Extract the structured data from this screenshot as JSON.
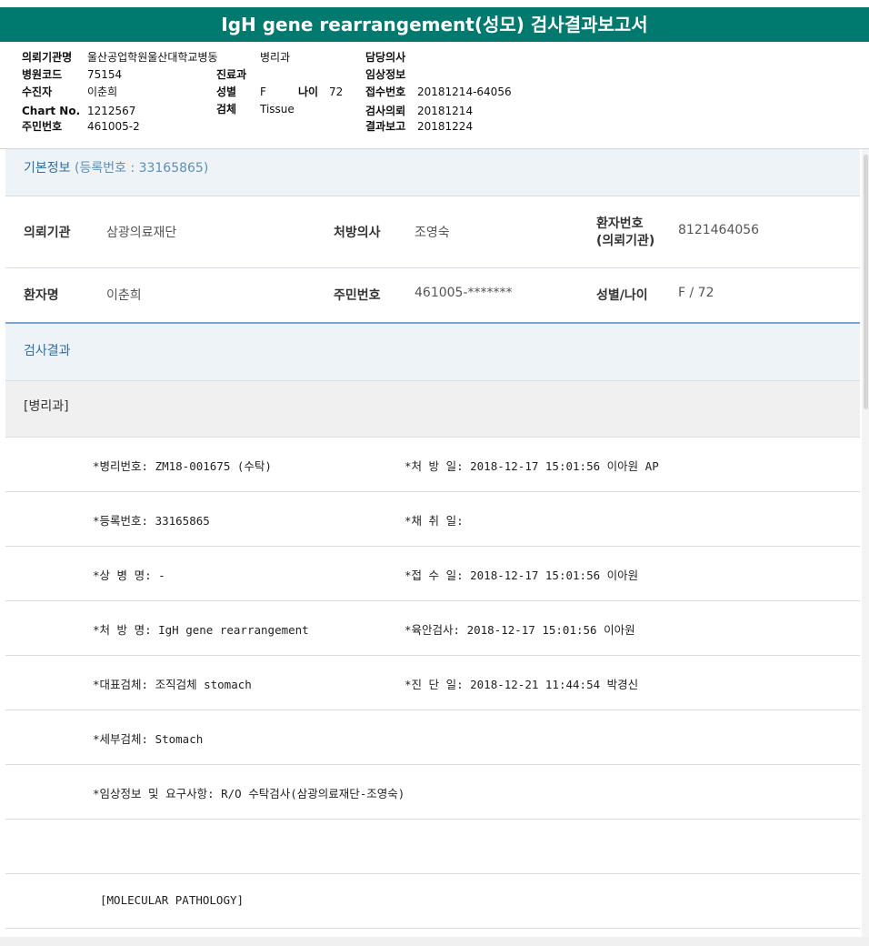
{
  "title": "IgH gene rearrangement(성모) 검사결과보고서",
  "header": {
    "req_inst_label": "의뢰기관명",
    "req_inst_value": "울산공업학원울산대학교병동",
    "ward_value": "병리과",
    "doctor_label": "담당의사",
    "hosp_code_label": "병원코드",
    "hosp_code_value": "75154",
    "dept_label": "진료과",
    "clinical_label": "임상정보",
    "patient_label": "수진자",
    "patient_value": "이춘희",
    "sex_label": "성별",
    "sex_value": "F",
    "age_label": "나이",
    "age_value": "72",
    "receipt_label": "접수번호",
    "receipt_value": "20181214-64056",
    "chart_label": "Chart No.",
    "chart_value": "1212567",
    "specimen_label": "검체",
    "specimen_value": "Tissue",
    "test_req_label": "검사의뢰",
    "test_req_value": "20181214",
    "id_label": "주민번호",
    "id_value": "461005-2",
    "report_label": "결과보고",
    "report_value": "20181224"
  },
  "basic": {
    "heading": "기본정보",
    "reg_note": "(등록번호 : 33165865)",
    "inst_label": "의뢰기관",
    "inst_value": "삼광의료재단",
    "presc_label": "처방의사",
    "presc_value": "조영숙",
    "patno_label1": "환자번호",
    "patno_label2": "(의뢰기관)",
    "patno_value": "8121464056",
    "name_label": "환자명",
    "name_value": "이춘희",
    "rrn_label": "주민번호",
    "rrn_value": "461005-*******",
    "sexage_label": "성별/나이",
    "sexage_value": "F / 72"
  },
  "results": {
    "heading": "검사결과",
    "dept": "[병리과]",
    "rows": [
      [
        "*병리번호: ZM18-001675 (수탁)",
        "*처 방 일: 2018-12-17 15:01:56  이아원 AP"
      ],
      [
        "*등록번호: 33165865",
        "*채 취 일:"
      ],
      [
        "*상 병 명: -",
        "*접 수 일: 2018-12-17 15:01:56  이아원"
      ],
      [
        "*처 방 명: IgH gene rearrangement",
        "*육안검사: 2018-12-17 15:01:56  이아원"
      ],
      [
        "*대표검체: 조직검체 stomach",
        "*진 단 일: 2018-12-21 11:44:54  박경신"
      ],
      [
        "*세부검체: Stomach",
        ""
      ],
      [
        "*임상정보 및 요구사항: R/O 수탁검사(삼광의료재단-조영숙)",
        ""
      ],
      [
        "",
        ""
      ],
      [
        "[MOLECULAR PATHOLOGY]",
        ""
      ]
    ]
  }
}
